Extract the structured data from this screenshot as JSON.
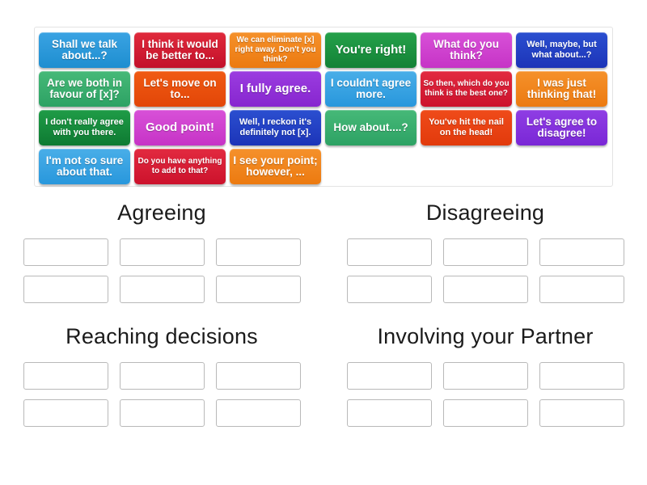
{
  "tray": {
    "name": "word-tile-tray",
    "rows": [
      [
        {
          "text": "Shall we talk about...?",
          "color": "#2a97d8",
          "skin": "c-blue",
          "size": "size-md"
        },
        {
          "text": "I think it would be better to...",
          "color": "#d4182f",
          "skin": "c-crimson",
          "size": "size-md"
        },
        {
          "text": "We can eliminate [x] right away. Don't you think?",
          "color": "#f0840f",
          "skin": "c-orange",
          "size": "size-xs"
        },
        {
          "text": "You're right!",
          "color": "#1a8a3e",
          "skin": "c-green",
          "size": "size-lg"
        },
        {
          "text": "What do you think?",
          "color": "#cf3ecf",
          "skin": "c-magenta",
          "size": "size-md"
        },
        {
          "text": "Well, maybe, but what about...?",
          "color": "#2240c4",
          "skin": "c-navy",
          "size": "size-sm"
        }
      ],
      [
        {
          "text": "Are we both in favour of [x]?",
          "color": "#37ab6d",
          "skin": "c-seagreen",
          "size": "size-md"
        },
        {
          "text": "Let's move on to...",
          "color": "#e94f0d",
          "skin": "c-orangered",
          "size": "size-md"
        },
        {
          "text": "I fully agree.",
          "color": "#9030d6",
          "skin": "c-purple",
          "size": "size-lg"
        },
        {
          "text": "I couldn't agree more.",
          "color": "#3ba2e2",
          "skin": "c-skyblue",
          "size": "size-md"
        },
        {
          "text": "So then, which do you think is the best one?",
          "color": "#d81b35",
          "skin": "c-red2",
          "size": "size-xs"
        },
        {
          "text": "I was just thinking that!",
          "color": "#f2860e",
          "skin": "c-orange",
          "size": "size-md"
        }
      ],
      [
        {
          "text": "I don't really agree with you there.",
          "color": "#168a39",
          "skin": "c-darkgreen",
          "size": "size-sm"
        },
        {
          "text": "Good point!",
          "color": "#cf3ecf",
          "skin": "c-magenta",
          "size": "size-lg"
        },
        {
          "text": "Well, I reckon it's definitely not [x].",
          "color": "#2240c4",
          "skin": "c-navy",
          "size": "size-sm"
        },
        {
          "text": "How about....?",
          "color": "#37ab6d",
          "skin": "c-seagreen",
          "size": "size-md"
        },
        {
          "text": "You've hit the nail on the head!",
          "color": "#e8400f",
          "skin": "c-vermilion",
          "size": "size-sm"
        },
        {
          "text": "Let's agree to disagree!",
          "color": "#8430dd",
          "skin": "c-violet",
          "size": "size-md"
        }
      ],
      [
        {
          "text": "I'm not so sure about that.",
          "color": "#3ba2e2",
          "skin": "c-skyblue",
          "size": "size-md"
        },
        {
          "text": "Do you have anything to add to that?",
          "color": "#d81b35",
          "skin": "c-red2",
          "size": "size-xs"
        },
        {
          "text": "I see your point; however, ...",
          "color": "#f0840f",
          "skin": "c-orange",
          "size": "size-md"
        },
        {
          "text": "",
          "color": "",
          "skin": "empty",
          "size": "size-md"
        },
        {
          "text": "",
          "color": "",
          "skin": "empty",
          "size": "size-md"
        },
        {
          "text": "",
          "color": "",
          "skin": "empty",
          "size": "size-md"
        }
      ]
    ]
  },
  "categories": [
    {
      "id": "agreeing",
      "title": "Agreeing",
      "slot_count": 6
    },
    {
      "id": "disagreeing",
      "title": "Disagreeing",
      "slot_count": 6
    },
    {
      "id": "reaching",
      "title": "Reaching decisions",
      "slot_count": 6
    },
    {
      "id": "involving",
      "title": "Involving your Partner",
      "slot_count": 6
    }
  ],
  "colors": {
    "page_background": "#ffffff",
    "slot_border": "#b9b9b9",
    "tray_border": "#e3e3e3",
    "title_text": "#1b1b1b",
    "tile_text": "#ffffff"
  }
}
